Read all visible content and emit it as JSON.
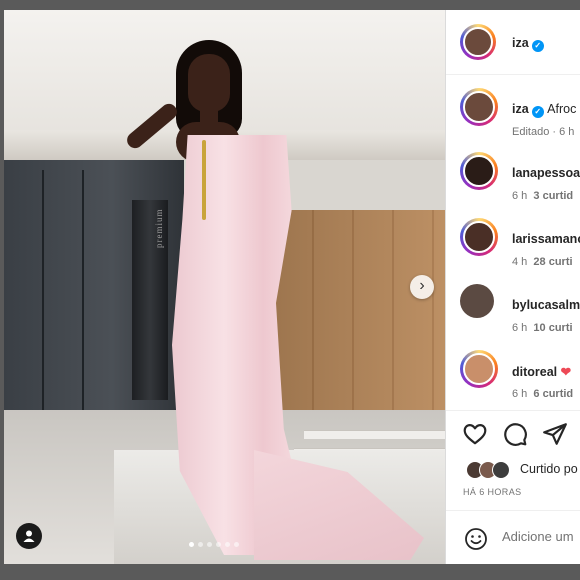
{
  "post": {
    "author": "iza",
    "verified": true,
    "caption_preview": "Afroc",
    "edited_label": "Editado · 6 h",
    "photo_text": "premium",
    "carousel": {
      "count": 6,
      "active": 0
    }
  },
  "comments": [
    {
      "user": "lanapessoa",
      "time": "6 h",
      "replies": "3 curtid",
      "face": "#2a1c17"
    },
    {
      "user": "larissamanoe",
      "time": "4 h",
      "replies": "28 curti",
      "face": "#4a2f26"
    },
    {
      "user": "bylucasalme",
      "time": "6 h",
      "replies": "10 curti",
      "face": "#5b4a42"
    },
    {
      "user": "ditoreal",
      "emoji": "❤",
      "time": "6 h",
      "replies": "6 curtid",
      "face": "#c98f6a"
    }
  ],
  "actions": {
    "liked_by": "Curtido po",
    "time_ago": "HÁ 6 HORAS",
    "liker_colors": [
      "#4b3a33",
      "#7a5a4c",
      "#3d3d3d"
    ]
  },
  "add_comment": {
    "placeholder": "Adicione um"
  },
  "icons": {
    "next": "chevron-right-icon",
    "tag": "user-tag-icon",
    "like": "heart-icon",
    "comment": "comment-icon",
    "share": "share-icon",
    "emoji": "emoji-icon",
    "verified": "verified-badge-icon"
  },
  "colors": {
    "verified": "#0095f6",
    "text": "#262626",
    "muted": "#737373",
    "heart": "#ed4956"
  }
}
